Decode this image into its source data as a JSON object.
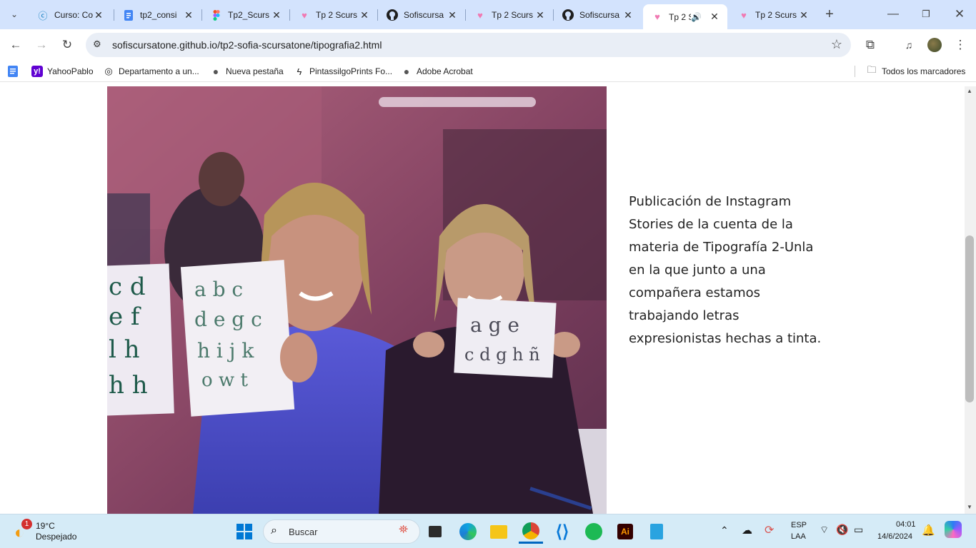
{
  "browser": {
    "tabs": [
      {
        "label": "Curso: Co",
        "icon": "course-icon",
        "active": false
      },
      {
        "label": "tp2_consi",
        "icon": "docs-icon",
        "active": false
      },
      {
        "label": "Tp2_Scurs",
        "icon": "figma-icon",
        "active": false
      },
      {
        "label": "Tp 2 Scurs",
        "icon": "heart-icon",
        "active": false
      },
      {
        "label": "Sofiscursa",
        "icon": "github-icon",
        "active": false
      },
      {
        "label": "Tp 2 Scurs",
        "icon": "heart-icon",
        "active": false
      },
      {
        "label": "Sofiscursa",
        "icon": "github-icon",
        "active": false
      },
      {
        "label": "Tp 2 S",
        "icon": "heart-icon",
        "active": true
      },
      {
        "label": "Tp 2 Scurs",
        "icon": "heart-icon",
        "active": false
      }
    ],
    "url": "sofiscursatone.github.io/tp2-sofia-scursatone/tipografia2.html",
    "bookmarks": [
      {
        "label": "YahooPablo",
        "icon": "yahoo-icon"
      },
      {
        "label": "Departamento a un...",
        "icon": "globe-icon"
      },
      {
        "label": "Nueva pestaña",
        "icon": "globe-icon"
      },
      {
        "label": "PintassilgoPrints Fo...",
        "icon": "bolt-icon"
      },
      {
        "label": "Adobe Acrobat",
        "icon": "globe-icon"
      }
    ],
    "all_bookmarks": "Todos los marcadores"
  },
  "page": {
    "caption": "Publicación de Instagram Stories de la cuenta de la materia de Tipografía 2-Unla en la que junto a una compañera estamos trabajando letras expresionistas hechas a tinta.",
    "photo": {
      "left_sheet_letters": [
        "c d",
        "e f",
        "l h",
        "h h"
      ],
      "middle_sheet_letters": [
        "a b c",
        "d e g c",
        "h i j k",
        "o w t"
      ],
      "right_sheet_letters": [
        "a g e",
        "c d g h ñ"
      ]
    }
  },
  "taskbar": {
    "weather_temp": "19°C",
    "weather_desc": "Despejado",
    "weather_badge": "1",
    "search_placeholder": "Buscar",
    "lang_line1": "ESP",
    "lang_line2": "LAA",
    "time": "04:01",
    "date": "14/6/2024",
    "ai_label": "Ai"
  }
}
